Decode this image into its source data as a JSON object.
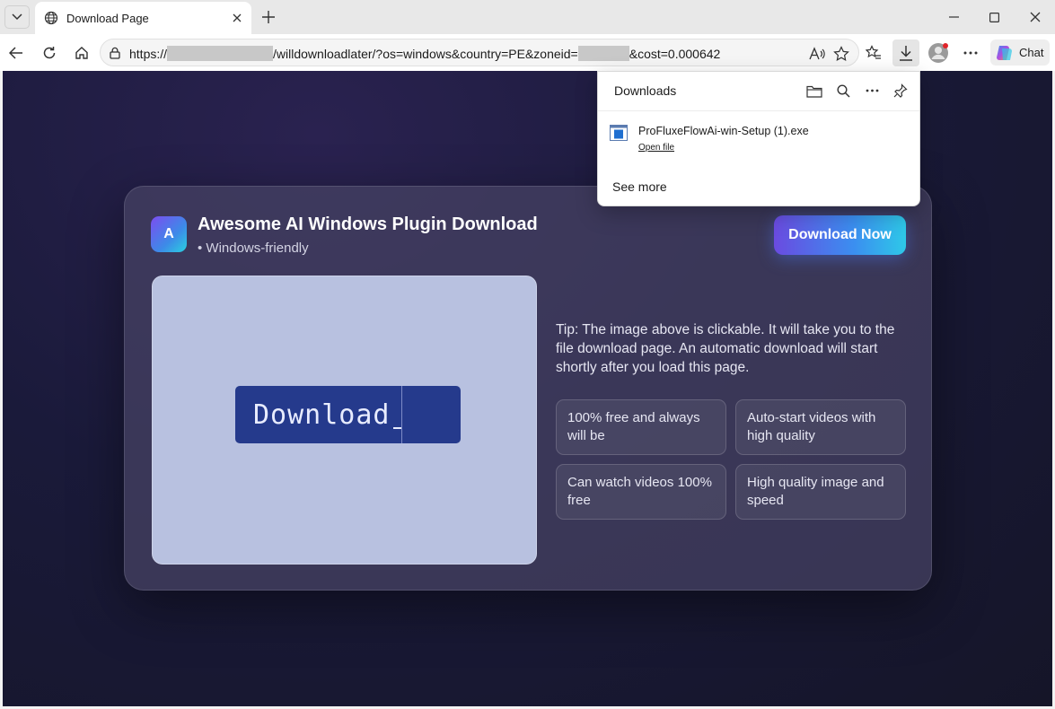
{
  "browser": {
    "tab": {
      "title": "Download Page"
    },
    "address": {
      "prefix": "https://",
      "suffix_after_redact1": "/willdownloadlater/?os=windows&country=PE&zoneid=",
      "suffix_after_redact2": "&cost=0.000642"
    },
    "chat_label": "Chat"
  },
  "downloads": {
    "header": "Downloads",
    "file_name": "ProFluxeFlowAi-win-Setup (1).exe",
    "open_file": "Open file",
    "see_more": "See more"
  },
  "page": {
    "logo_letter": "A",
    "title": "Awesome AI Windows Plugin Download",
    "subtitle": "• Windows-friendly",
    "download_now": "Download Now",
    "image_button_label": "Download",
    "tip": "Tip: The image above is clickable. It will take you to the file download page. An automatic download will start shortly after you load this page.",
    "features": [
      "100% free and always will be",
      "Auto-start videos with high quality",
      "Can watch videos 100% free",
      "High quality image and speed"
    ]
  },
  "colors": {
    "accent_gradient_start": "#6a4be0",
    "accent_gradient_end": "#2ec8e8",
    "page_background": "#1a1a3a",
    "image_button": "#253a8c"
  },
  "icons": {
    "tab_list": "chevron-down-icon",
    "tab_favicon": "globe-icon",
    "tab_close": "close-icon",
    "new_tab": "plus-icon",
    "minimize": "minimize-icon",
    "maximize": "maximize-icon",
    "close": "close-icon",
    "back": "back-arrow-icon",
    "refresh": "refresh-icon",
    "home": "home-icon",
    "lock": "lock-icon",
    "read_aloud": "read-aloud-icon",
    "favorite": "star-icon",
    "favorites": "favorites-icon",
    "downloads": "download-icon",
    "profile": "profile-icon",
    "more": "more-icon",
    "copilot": "copilot-icon",
    "folder": "folder-icon",
    "search": "search-icon",
    "pin": "pin-icon",
    "file": "exe-file-icon"
  }
}
